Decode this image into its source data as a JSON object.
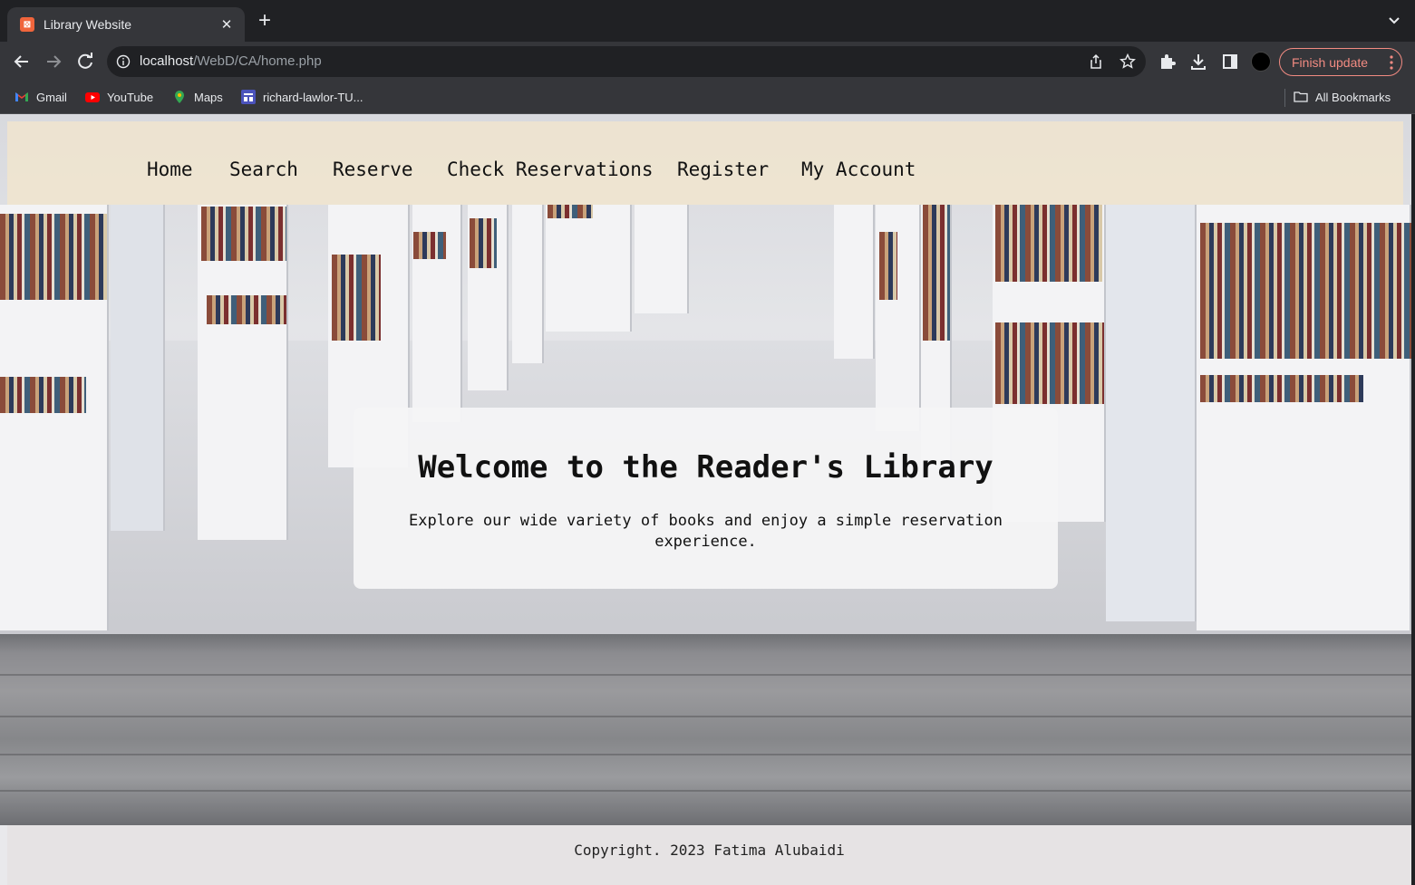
{
  "browser": {
    "tab_title": "Library Website",
    "url_host": "localhost",
    "url_path": "/WebD/CA/home.php",
    "finish_update_label": "Finish update",
    "bookmarks": [
      "Gmail",
      "YouTube",
      "Maps",
      "richard-lawlor-TU..."
    ],
    "all_bookmarks_label": "All Bookmarks",
    "icons": [
      "back-icon",
      "forward-icon",
      "reload-icon",
      "info-icon",
      "share-icon",
      "star-icon",
      "extensions-icon",
      "download-icon",
      "sidepanel-icon",
      "kebab-icon",
      "chevron-down-icon",
      "folder-icon"
    ]
  },
  "nav": {
    "items": [
      "Home",
      "Search",
      "Reserve",
      "Check Reservations",
      "Register",
      "My Account"
    ]
  },
  "hero": {
    "title": "Welcome to the Reader's Library",
    "subtitle": "Explore our wide variety of books and enjoy a simple reservation experience."
  },
  "footer": {
    "copyright": "Copyright. 2023 Fatima Alubaidi"
  }
}
